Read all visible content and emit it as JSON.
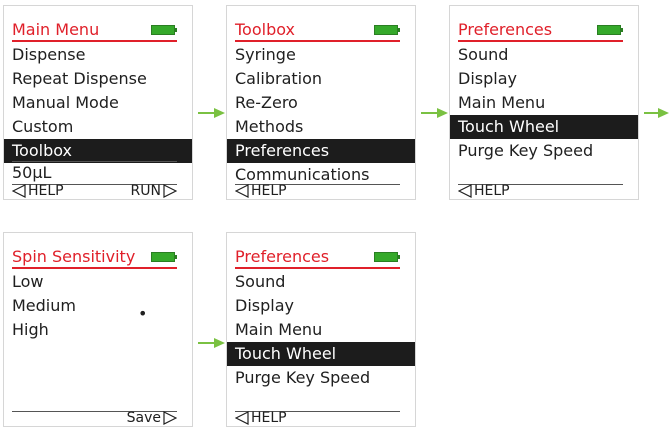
{
  "screens": [
    {
      "title": "Main Menu",
      "items": [
        "Dispense",
        "Repeat Dispense",
        "Manual Mode",
        "Custom",
        "Toolbox"
      ],
      "selected": 4,
      "value": "50µL",
      "footer": {
        "left": "HELP",
        "right": "RUN"
      }
    },
    {
      "title": "Toolbox",
      "items": [
        "Syringe",
        "Calibration",
        "Re-Zero",
        "Methods",
        "Preferences",
        "Communications"
      ],
      "selected": 4,
      "footer": {
        "left": "HELP",
        "right": ""
      }
    },
    {
      "title": "Preferences",
      "items": [
        "Sound",
        "Display",
        "Main Menu",
        "Touch Wheel",
        "Purge Key Speed"
      ],
      "selected": 3,
      "footer": {
        "left": "HELP",
        "right": ""
      }
    },
    {
      "title": "Spin Sensitivity",
      "items": [
        "Low",
        "Medium",
        "High"
      ],
      "selected": -1,
      "marker": "•",
      "footer": {
        "left": "",
        "right": "Save"
      }
    },
    {
      "title": "Preferences",
      "items": [
        "Sound",
        "Display",
        "Main Menu",
        "Touch Wheel",
        "Purge Key Speed"
      ],
      "selected": 3,
      "footer": {
        "left": "HELP",
        "right": ""
      }
    }
  ],
  "colors": {
    "title": "#e0202a",
    "battery": "#35a92a",
    "arrow": "#7ac142",
    "selected_bg": "#1c1c1c"
  }
}
